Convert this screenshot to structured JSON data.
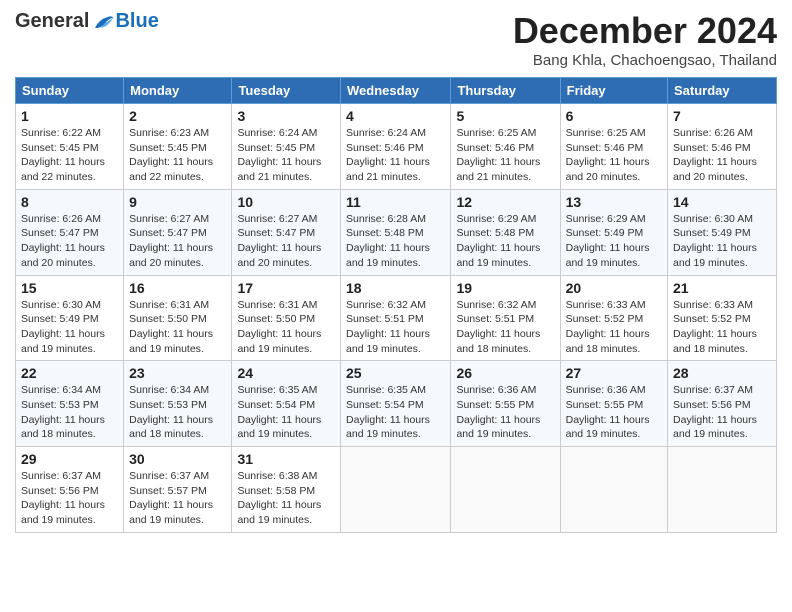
{
  "header": {
    "logo_general": "General",
    "logo_blue": "Blue",
    "month_title": "December 2024",
    "subtitle": "Bang Khla, Chachoengsao, Thailand"
  },
  "days_of_week": [
    "Sunday",
    "Monday",
    "Tuesday",
    "Wednesday",
    "Thursday",
    "Friday",
    "Saturday"
  ],
  "weeks": [
    [
      {
        "day": "1",
        "info": "Sunrise: 6:22 AM\nSunset: 5:45 PM\nDaylight: 11 hours and 22 minutes."
      },
      {
        "day": "2",
        "info": "Sunrise: 6:23 AM\nSunset: 5:45 PM\nDaylight: 11 hours and 22 minutes."
      },
      {
        "day": "3",
        "info": "Sunrise: 6:24 AM\nSunset: 5:45 PM\nDaylight: 11 hours and 21 minutes."
      },
      {
        "day": "4",
        "info": "Sunrise: 6:24 AM\nSunset: 5:46 PM\nDaylight: 11 hours and 21 minutes."
      },
      {
        "day": "5",
        "info": "Sunrise: 6:25 AM\nSunset: 5:46 PM\nDaylight: 11 hours and 21 minutes."
      },
      {
        "day": "6",
        "info": "Sunrise: 6:25 AM\nSunset: 5:46 PM\nDaylight: 11 hours and 20 minutes."
      },
      {
        "day": "7",
        "info": "Sunrise: 6:26 AM\nSunset: 5:46 PM\nDaylight: 11 hours and 20 minutes."
      }
    ],
    [
      {
        "day": "8",
        "info": "Sunrise: 6:26 AM\nSunset: 5:47 PM\nDaylight: 11 hours and 20 minutes."
      },
      {
        "day": "9",
        "info": "Sunrise: 6:27 AM\nSunset: 5:47 PM\nDaylight: 11 hours and 20 minutes."
      },
      {
        "day": "10",
        "info": "Sunrise: 6:27 AM\nSunset: 5:47 PM\nDaylight: 11 hours and 20 minutes."
      },
      {
        "day": "11",
        "info": "Sunrise: 6:28 AM\nSunset: 5:48 PM\nDaylight: 11 hours and 19 minutes."
      },
      {
        "day": "12",
        "info": "Sunrise: 6:29 AM\nSunset: 5:48 PM\nDaylight: 11 hours and 19 minutes."
      },
      {
        "day": "13",
        "info": "Sunrise: 6:29 AM\nSunset: 5:49 PM\nDaylight: 11 hours and 19 minutes."
      },
      {
        "day": "14",
        "info": "Sunrise: 6:30 AM\nSunset: 5:49 PM\nDaylight: 11 hours and 19 minutes."
      }
    ],
    [
      {
        "day": "15",
        "info": "Sunrise: 6:30 AM\nSunset: 5:49 PM\nDaylight: 11 hours and 19 minutes."
      },
      {
        "day": "16",
        "info": "Sunrise: 6:31 AM\nSunset: 5:50 PM\nDaylight: 11 hours and 19 minutes."
      },
      {
        "day": "17",
        "info": "Sunrise: 6:31 AM\nSunset: 5:50 PM\nDaylight: 11 hours and 19 minutes."
      },
      {
        "day": "18",
        "info": "Sunrise: 6:32 AM\nSunset: 5:51 PM\nDaylight: 11 hours and 19 minutes."
      },
      {
        "day": "19",
        "info": "Sunrise: 6:32 AM\nSunset: 5:51 PM\nDaylight: 11 hours and 18 minutes."
      },
      {
        "day": "20",
        "info": "Sunrise: 6:33 AM\nSunset: 5:52 PM\nDaylight: 11 hours and 18 minutes."
      },
      {
        "day": "21",
        "info": "Sunrise: 6:33 AM\nSunset: 5:52 PM\nDaylight: 11 hours and 18 minutes."
      }
    ],
    [
      {
        "day": "22",
        "info": "Sunrise: 6:34 AM\nSunset: 5:53 PM\nDaylight: 11 hours and 18 minutes."
      },
      {
        "day": "23",
        "info": "Sunrise: 6:34 AM\nSunset: 5:53 PM\nDaylight: 11 hours and 18 minutes."
      },
      {
        "day": "24",
        "info": "Sunrise: 6:35 AM\nSunset: 5:54 PM\nDaylight: 11 hours and 19 minutes."
      },
      {
        "day": "25",
        "info": "Sunrise: 6:35 AM\nSunset: 5:54 PM\nDaylight: 11 hours and 19 minutes."
      },
      {
        "day": "26",
        "info": "Sunrise: 6:36 AM\nSunset: 5:55 PM\nDaylight: 11 hours and 19 minutes."
      },
      {
        "day": "27",
        "info": "Sunrise: 6:36 AM\nSunset: 5:55 PM\nDaylight: 11 hours and 19 minutes."
      },
      {
        "day": "28",
        "info": "Sunrise: 6:37 AM\nSunset: 5:56 PM\nDaylight: 11 hours and 19 minutes."
      }
    ],
    [
      {
        "day": "29",
        "info": "Sunrise: 6:37 AM\nSunset: 5:56 PM\nDaylight: 11 hours and 19 minutes."
      },
      {
        "day": "30",
        "info": "Sunrise: 6:37 AM\nSunset: 5:57 PM\nDaylight: 11 hours and 19 minutes."
      },
      {
        "day": "31",
        "info": "Sunrise: 6:38 AM\nSunset: 5:58 PM\nDaylight: 11 hours and 19 minutes."
      },
      null,
      null,
      null,
      null
    ]
  ]
}
